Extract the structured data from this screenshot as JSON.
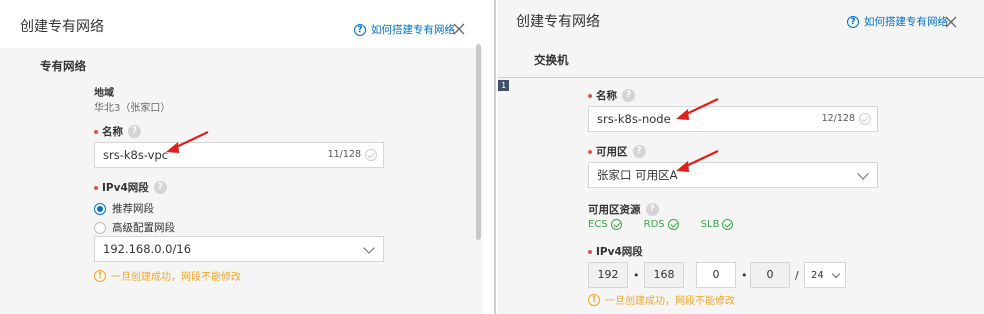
{
  "left": {
    "title": "创建专有网络",
    "help_link": "如何搭建专有网络",
    "section_title": "专有网络",
    "region_label": "地域",
    "region_value": "华北3（张家口）",
    "name_label": "名称",
    "name_value": "srs-k8s-vpc",
    "name_counter": "11/128",
    "ipv4_label": "IPv4网段",
    "radio_options": [
      {
        "label": "推荐网段",
        "checked": true
      },
      {
        "label": "高级配置网段",
        "checked": false
      }
    ],
    "cidr_value": "192.168.0.0/16",
    "warning": "一旦创建成功，网段不能修改"
  },
  "right": {
    "title": "创建专有网络",
    "help_link": "如何搭建专有网络",
    "section_title": "交换机",
    "line_number": "1",
    "name_label": "名称",
    "name_value": "srs-k8s-node",
    "name_counter": "12/128",
    "zone_label": "可用区",
    "zone_value": "张家口 可用区A",
    "zone_resources_label": "可用区资源",
    "resources": [
      "ECS",
      "RDS",
      "SLB"
    ],
    "ipv4_label": "IPv4网段",
    "ip_octets": [
      "192",
      "168",
      "0",
      "0"
    ],
    "ip_dot": "•",
    "ip_slash": "/",
    "mask": "24",
    "warning": "一旦创建成功，网段不能修改"
  },
  "colors": {
    "link": "#0070cc",
    "required": "#e35150",
    "warning": "#f5a623",
    "success": "#39a846",
    "annotation_arrow": "#e0201b"
  },
  "icons": [
    "help-circle-icon",
    "close-icon",
    "question-icon",
    "check-circle-icon",
    "chevron-down-icon",
    "warning-icon",
    "ok-circle-icon",
    "red-arrow-annotation"
  ]
}
